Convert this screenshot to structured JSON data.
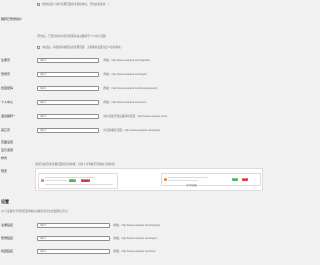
{
  "top_option": {
    "text": "(启用自定义用户注册页面的主链接地址，开启后将生效…)"
  },
  "redirect_note": {
    "title": "跳转已登录用户",
    "text": "(开启后，已登录用户访问注册页将自动跳转至个人中心页面)"
  },
  "inherit_option": {
    "text": "(勾选后，将使用系统默认的注册页面，无需额外设置自定义链接地址)"
  },
  "url_fields": [
    {
      "label": "注册页",
      "value": "http://",
      "hint": "(例如：http://www.example.com/register)"
    },
    {
      "label": "登录页",
      "value": "http://",
      "hint": "(例如：http://www.example.com/login)"
    },
    {
      "label": "找回密码",
      "value": "http://",
      "hint": "(例如：http://www.example.com/lost-password)"
    },
    {
      "label": "个人中心",
      "value": "http://",
      "hint": "(例如：http://www.example.com/user)"
    },
    {
      "label": "退出跳转 *",
      "value": "http://",
      "hint": "(用户退出登录后跳转的页面：http://www.example.com/)"
    },
    {
      "label": "其它页",
      "value": "http://",
      "hint": "(可选的额外页面：http://www.example.com/page)"
    }
  ],
  "extra_labels": [
    "页面设置",
    "显示选项",
    "样式"
  ],
  "preview": {
    "label": "预览",
    "text": "(预览当前登录/注册页面的显示效果，可在下方查看不同状态下的样式)",
    "status_pill": "已登录",
    "pill_left_b": "立即注册",
    "pill_right_a": "登录",
    "pill_right_b": "注册",
    "caption": "(示例效果)"
  },
  "settings_section": {
    "title": "设置",
    "desc": "(以下设置用于控制页面中相关功能的显示方式和默认行为)",
    "fields": [
      {
        "label": "注册链接",
        "value": "http://",
        "hint": "(例如：http://www.example.com/register)"
      },
      {
        "label": "登录链接",
        "value": "http://",
        "hint": "(例如：http://www.example.com/login)"
      },
      {
        "label": "找回链接",
        "value": "http://",
        "hint": "(例如：http://www.example.com/lost)"
      }
    ]
  },
  "colors": {
    "green": "#46b450",
    "red": "#dc3232",
    "orange": "#f0883e",
    "accent_blue": "#2271b1"
  }
}
